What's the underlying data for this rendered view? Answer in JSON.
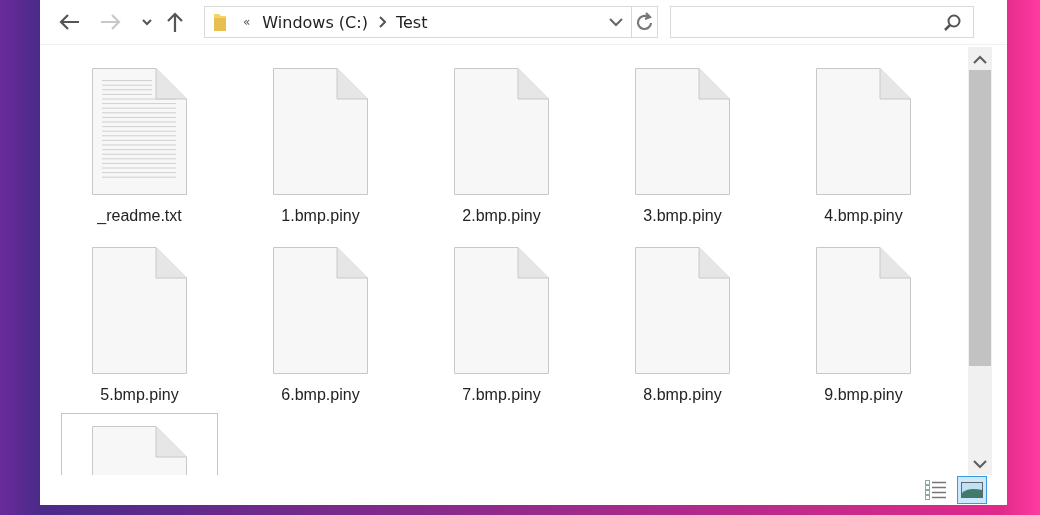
{
  "nav": {
    "back_disabled": false,
    "forward_disabled": true
  },
  "address": {
    "overflow": "«",
    "crumbs": [
      {
        "label": "Windows (C:)"
      },
      {
        "label": "Test"
      }
    ]
  },
  "files": [
    {
      "name": "_readme.txt",
      "kind": "text",
      "highlighted": false
    },
    {
      "name": "1.bmp.piny",
      "kind": "blank",
      "highlighted": false
    },
    {
      "name": "2.bmp.piny",
      "kind": "blank",
      "highlighted": false
    },
    {
      "name": "3.bmp.piny",
      "kind": "blank",
      "highlighted": false
    },
    {
      "name": "4.bmp.piny",
      "kind": "blank",
      "highlighted": false
    },
    {
      "name": "5.bmp.piny",
      "kind": "blank",
      "highlighted": false
    },
    {
      "name": "6.bmp.piny",
      "kind": "blank",
      "highlighted": false
    },
    {
      "name": "7.bmp.piny",
      "kind": "blank",
      "highlighted": false
    },
    {
      "name": "8.bmp.piny",
      "kind": "blank",
      "highlighted": false
    },
    {
      "name": "9.bmp.piny",
      "kind": "blank",
      "highlighted": false
    },
    {
      "kind": "blank",
      "highlighted": true
    }
  ],
  "view_modes": [
    {
      "kind": "details",
      "selected": false
    },
    {
      "kind": "large-icons",
      "selected": true
    }
  ]
}
